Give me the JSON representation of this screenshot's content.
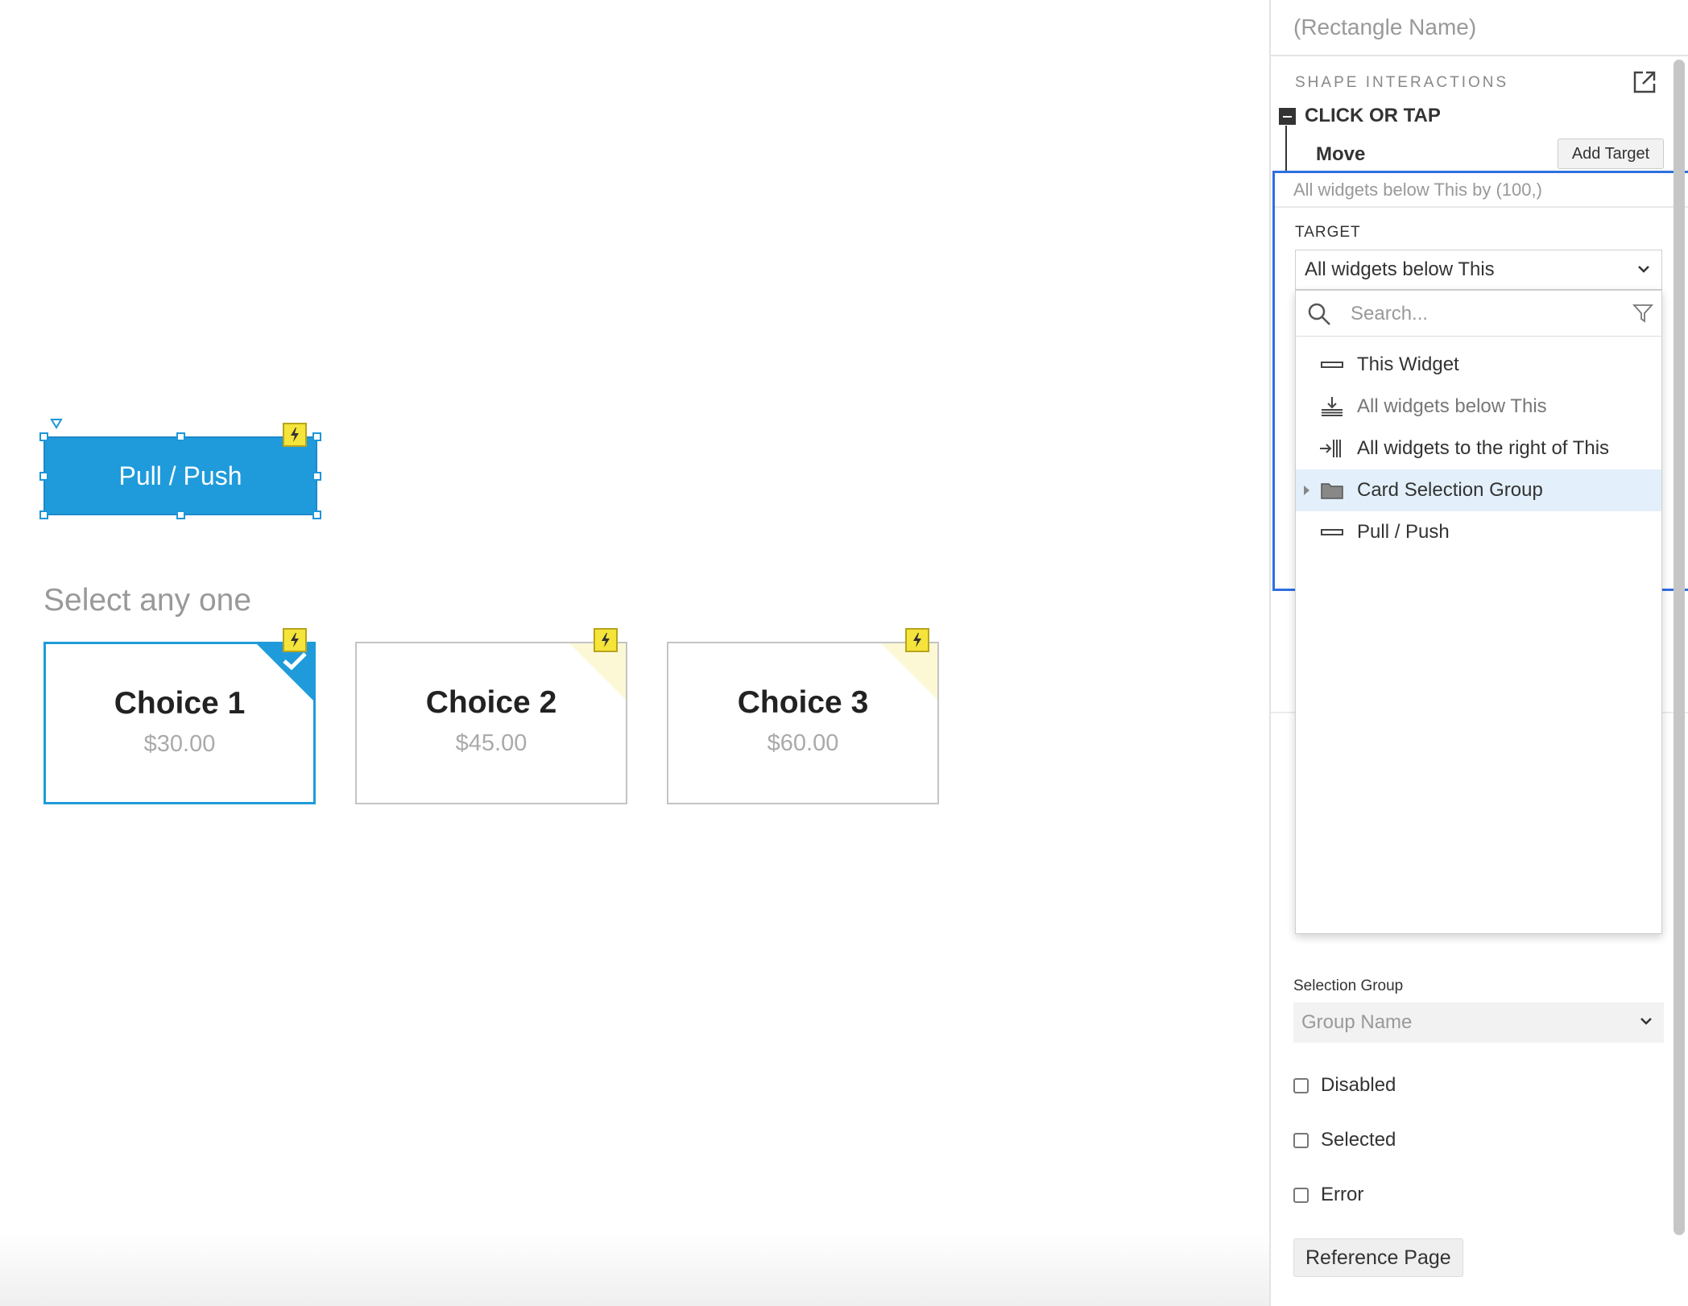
{
  "canvas": {
    "button_label": "Pull / Push",
    "prompt": "Select any one",
    "cards": [
      {
        "name": "Choice 1",
        "price": "$30.00",
        "selected": true
      },
      {
        "name": "Choice 2",
        "price": "$45.00",
        "selected": false
      },
      {
        "name": "Choice 3",
        "price": "$60.00",
        "selected": false
      }
    ]
  },
  "panel": {
    "widget_name_placeholder": "(Rectangle Name)",
    "section_title": "SHAPE INTERACTIONS",
    "event": "CLICK OR TAP",
    "action": "Move",
    "add_target_label": "Add Target",
    "action_summary": "All widgets below This by (100,)",
    "target_label": "TARGET",
    "target_value": "All widgets below This",
    "dropdown": {
      "search_placeholder": "Search...",
      "items": [
        {
          "label": "This Widget",
          "icon": "widget-rect-icon",
          "muted": false
        },
        {
          "label": "All widgets below This",
          "icon": "align-bottom-icon",
          "muted": true
        },
        {
          "label": "All widgets to the right of This",
          "icon": "align-right-icon",
          "muted": false
        },
        {
          "label": "Card Selection Group",
          "icon": "folder-icon",
          "muted": false,
          "highlight": true,
          "expandable": true
        },
        {
          "label": "Pull / Push",
          "icon": "widget-rect-icon",
          "muted": false
        }
      ]
    },
    "selection_group_label": "Selection Group",
    "selection_group_placeholder": "Group Name",
    "checkboxes": [
      {
        "label": "Disabled",
        "checked": false
      },
      {
        "label": "Selected",
        "checked": false
      },
      {
        "label": "Error",
        "checked": false
      }
    ],
    "reference_page_label": "Reference Page"
  },
  "colors": {
    "accent": "#1f9bdb",
    "selection_blue": "#2f6fe0",
    "interaction_badge": "#f5e43a"
  }
}
